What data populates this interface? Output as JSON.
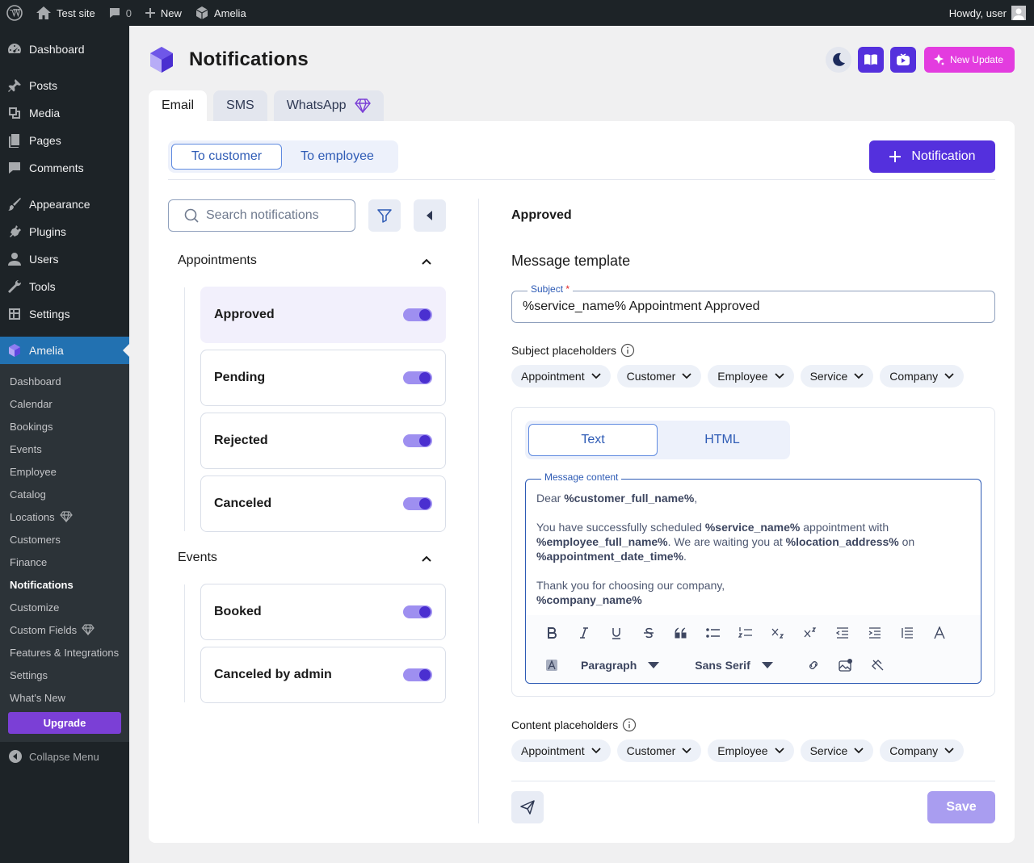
{
  "admin_bar": {
    "site_name": "Test site",
    "comments_count": "0",
    "new_label": "New",
    "plugin_label": "Amelia",
    "greeting": "Howdy, user"
  },
  "sidebar": {
    "items": [
      {
        "label": "Dashboard",
        "icon": "dashboard-icon"
      },
      {
        "label": "Posts",
        "icon": "pin-icon"
      },
      {
        "label": "Media",
        "icon": "media-icon"
      },
      {
        "label": "Pages",
        "icon": "pages-icon"
      },
      {
        "label": "Comments",
        "icon": "comment-icon"
      },
      {
        "label": "Appearance",
        "icon": "brush-icon"
      },
      {
        "label": "Plugins",
        "icon": "plug-icon"
      },
      {
        "label": "Users",
        "icon": "user-icon"
      },
      {
        "label": "Tools",
        "icon": "wrench-icon"
      },
      {
        "label": "Settings",
        "icon": "settings-icon"
      }
    ],
    "amelia_label": "Amelia",
    "submenu": [
      "Dashboard",
      "Calendar",
      "Bookings",
      "Events",
      "Employee",
      "Catalog",
      "Locations",
      "Customers",
      "Finance",
      "Notifications",
      "Customize",
      "Custom Fields",
      "Features & Integrations",
      "Settings",
      "What's New"
    ],
    "current_submenu": "Notifications",
    "upgrade_label": "Upgrade",
    "collapse_label": "Collapse Menu"
  },
  "header": {
    "title": "Notifications",
    "new_update_label": "New Update"
  },
  "tabs": [
    {
      "label": "Email",
      "active": true
    },
    {
      "label": "SMS",
      "active": false
    },
    {
      "label": "WhatsApp",
      "active": false
    }
  ],
  "recipient_toggle": {
    "to_customer": "To customer",
    "to_employee": "To employee",
    "selected": "To customer"
  },
  "add_notification_label": "Notification",
  "search": {
    "placeholder": "Search notifications",
    "value": ""
  },
  "groups": [
    {
      "title": "Appointments",
      "items": [
        {
          "label": "Approved",
          "enabled": true,
          "selected": true
        },
        {
          "label": "Pending",
          "enabled": true,
          "selected": false
        },
        {
          "label": "Rejected",
          "enabled": true,
          "selected": false
        },
        {
          "label": "Canceled",
          "enabled": true,
          "selected": false
        }
      ]
    },
    {
      "title": "Events",
      "items": [
        {
          "label": "Booked",
          "enabled": true,
          "selected": false
        },
        {
          "label": "Canceled by admin",
          "enabled": true,
          "selected": false
        }
      ]
    }
  ],
  "detail": {
    "title": "Approved",
    "template_title": "Message template",
    "subject_label": "Subject",
    "subject_required": "*",
    "subject_value": "%service_name% Appointment Approved",
    "subject_placeholders_label": "Subject placeholders",
    "placeholder_chips": [
      "Appointment",
      "Customer",
      "Employee",
      "Service",
      "Company"
    ],
    "editor_modes": {
      "text": "Text",
      "html": "HTML",
      "selected": "Text"
    },
    "message_label": "Message content",
    "message": {
      "greeting_prefix": "Dear ",
      "greeting_ph": "%customer_full_name%",
      "greeting_suffix": ",",
      "line1_a": "You have successfully scheduled ",
      "line1_ph1": "%service_name%",
      "line1_b": " appointment with ",
      "line1_ph2": "%employee_full_name%",
      "line1_c": ". We are waiting you at ",
      "line1_ph3": "%location_address%",
      "line1_d": " on ",
      "line1_ph4": "%appointment_date_time%",
      "line1_e": ".",
      "thanks": "Thank you for choosing our company,",
      "signature_ph": "%company_name%"
    },
    "toolbar": {
      "paragraph_label": "Paragraph",
      "font_label": "Sans Serif"
    },
    "content_placeholders_label": "Content placeholders",
    "save_label": "Save"
  },
  "colors": {
    "primary": "#5430dd",
    "accent_pink": "#e33cdf",
    "wp_admin_bg": "#1d2327",
    "wp_active": "#2271b1",
    "save_disabled": "#a99df0"
  }
}
